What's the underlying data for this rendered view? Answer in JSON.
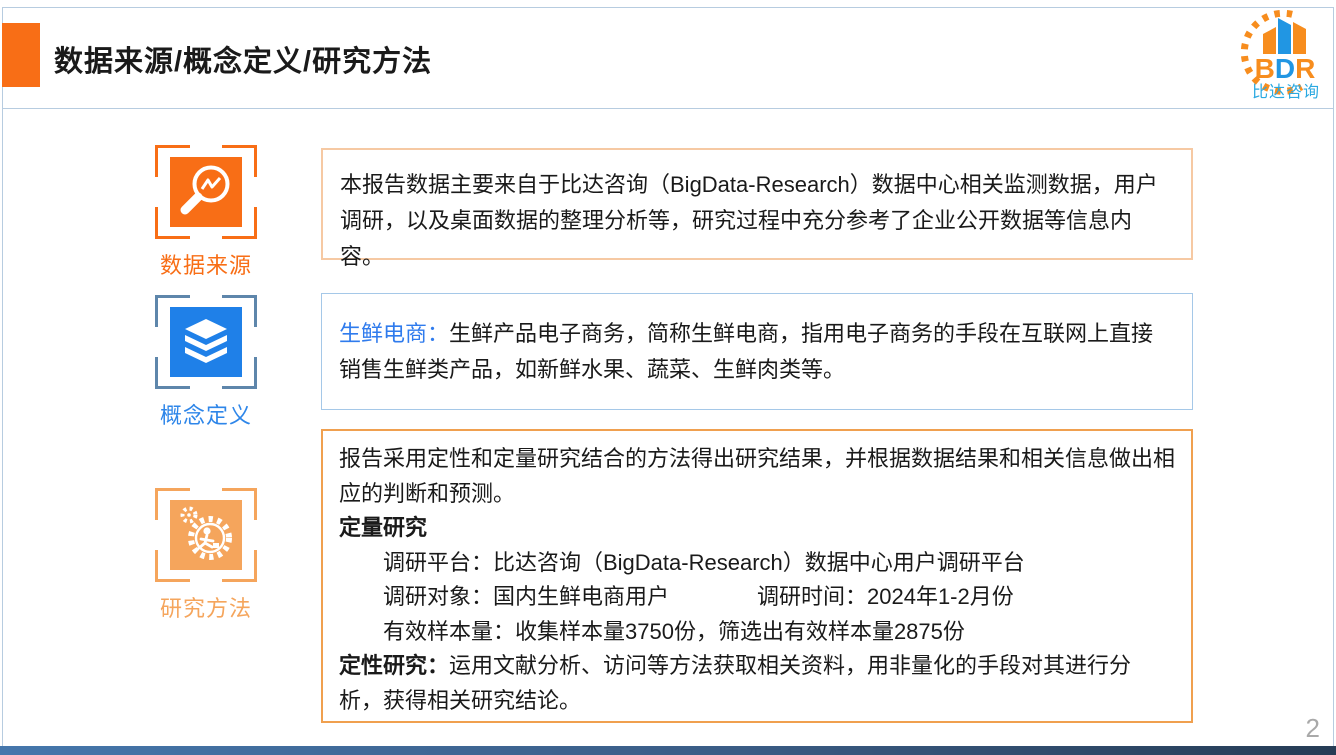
{
  "header": {
    "title": "数据来源/概念定义/研究方法"
  },
  "logo": {
    "letters": [
      "B",
      "D",
      "R"
    ],
    "caption": "比达咨询"
  },
  "sections": [
    {
      "label": "数据来源",
      "icon": "magnifier-chart-icon"
    },
    {
      "label": "概念定义",
      "icon": "layers-stack-icon"
    },
    {
      "label": "研究方法",
      "icon": "gears-person-icon"
    }
  ],
  "boxes": {
    "source_text": "本报告数据主要来自于比达咨询（BigData-Research）数据中心相关监测数据，用户调研，以及桌面数据的整理分析等，研究过程中充分参考了企业公开数据等信息内容。",
    "definition": {
      "term": "生鲜电商：",
      "text": "生鲜产品电子商务，简称生鲜电商，指用电子商务的手段在互联网上直接销售生鲜类产品，如新鲜水果、蔬菜、生鲜肉类等。"
    },
    "method": {
      "intro": "报告采用定性和定量研究结合的方法得出研究结果，并根据数据结果和相关信息做出相应的判断和预测。",
      "quant_heading": "定量研究",
      "quant_items": [
        "调研平台：比达咨询（BigData-Research）数据中心用户调研平台",
        "调研对象：国内生鲜电商用户　　　　调研时间：2024年1-2月份",
        "有效样本量：收集样本量3750份，筛选出有效样本量2875份"
      ],
      "qual_heading": "定性研究：",
      "qual_text": "运用文献分析、访问等方法获取相关资料，用非量化的手段对其进行分析，获得相关研究结论。"
    }
  },
  "footer": {
    "page_number": "2"
  },
  "colors": {
    "accent_orange": "#F86E16",
    "soft_orange": "#F5A55C",
    "box1_border": "#F6C9A3",
    "box3_border": "#F0A04F",
    "blue_icon": "#1F80E8",
    "blue_label": "#2E86E9",
    "frame_blue": "#5E86AB",
    "box2_border": "#A5C8E8",
    "term_blue": "#2F7BED",
    "logo_orange": "#F78D1E",
    "logo_blue": "#2196E3",
    "logo_caption_blue": "#2BA9E1",
    "divider_blue": "#B7CCE0",
    "page_gray": "#A9A9A9",
    "text_dark": "#1A1A1A"
  }
}
